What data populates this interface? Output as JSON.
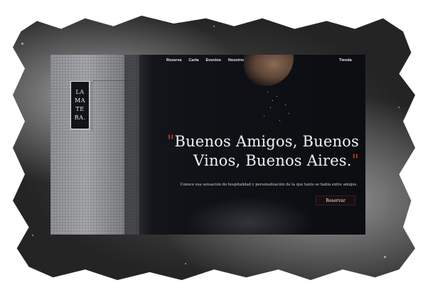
{
  "brand": {
    "logo_lines": [
      "LA",
      "MA",
      "TE",
      "RA."
    ]
  },
  "nav": {
    "items": [
      "Reserva",
      "Carta",
      "Eventos",
      "Nosotros"
    ],
    "store": "Tienda"
  },
  "hero": {
    "quote_open": "\"",
    "headline_line1": "Buenos Amigos, Buenos",
    "headline_line2": "Vinos, Buenos Aires.",
    "quote_close": "\"",
    "subtitle": "Conoce esa sensación de hospitalidad y personalización de la que tanto se habla entre amigos.",
    "cta": "Reservar"
  },
  "colors": {
    "accent": "#c0392b",
    "background": "#101217",
    "frame": "#3a3a3a"
  }
}
